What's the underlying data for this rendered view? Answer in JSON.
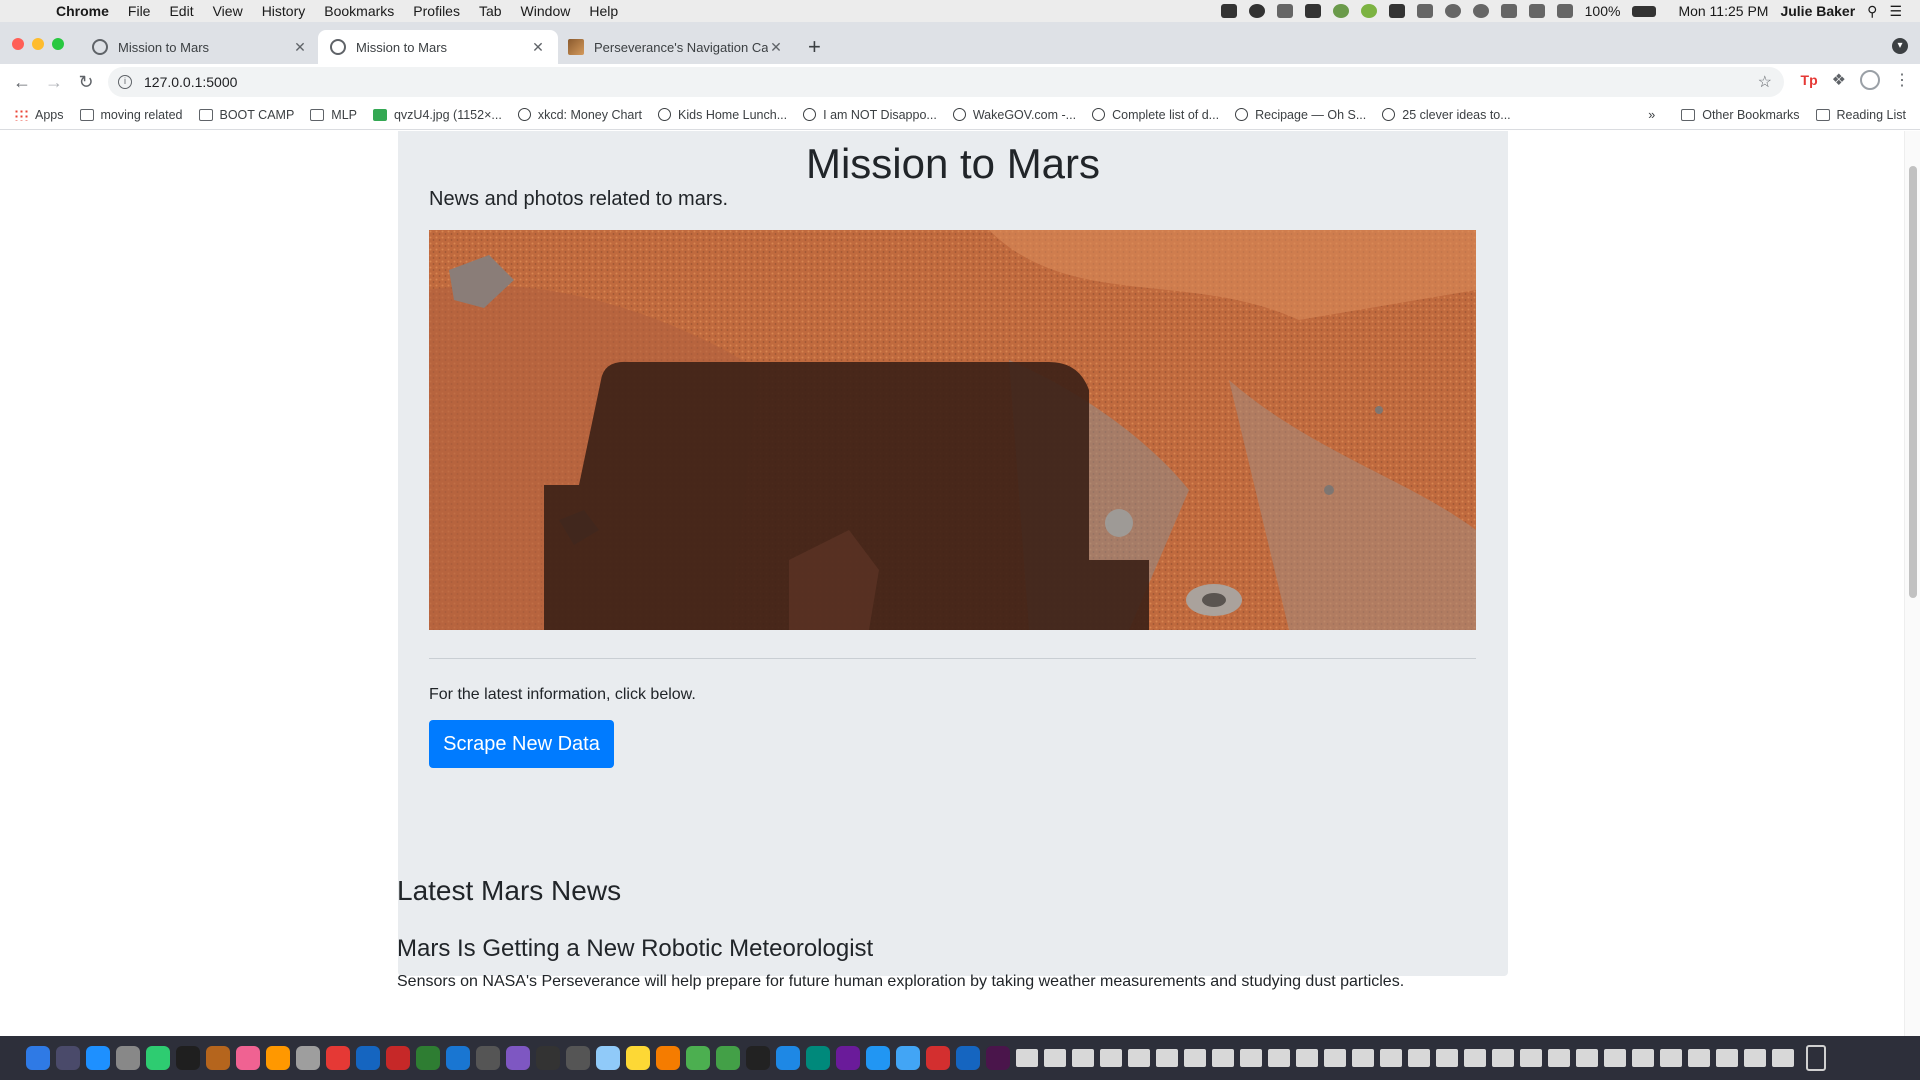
{
  "menubar": {
    "apple_glyph": "",
    "app_name": "Chrome",
    "items": [
      "File",
      "Edit",
      "View",
      "History",
      "Bookmarks",
      "Profiles",
      "Tab",
      "Window",
      "Help"
    ],
    "battery": "100%",
    "clock": "Mon 11:25 PM",
    "user": "Julie Baker"
  },
  "tabs": [
    {
      "title": "Mission to Mars",
      "active": false
    },
    {
      "title": "Mission to Mars",
      "active": true
    },
    {
      "title": "Perseverance's Navigation Cam",
      "active": false
    }
  ],
  "toolbar": {
    "url": "127.0.0.1:5000",
    "extension_label": "Tp"
  },
  "bookmarks": {
    "items": [
      {
        "label": "Apps",
        "icon": "apps-grid-icon"
      },
      {
        "label": "moving related",
        "icon": "folder-icon"
      },
      {
        "label": "BOOT CAMP",
        "icon": "folder-icon"
      },
      {
        "label": "MLP",
        "icon": "folder-icon"
      },
      {
        "label": "qvzU4.jpg (1152×...",
        "icon": "image-icon"
      },
      {
        "label": "xkcd: Money Chart",
        "icon": "globe-icon"
      },
      {
        "label": "Kids Home Lunch...",
        "icon": "globe-icon"
      },
      {
        "label": "I am NOT Disappo...",
        "icon": "globe-icon"
      },
      {
        "label": "WakeGOV.com -...",
        "icon": "globe-icon"
      },
      {
        "label": "Complete list of d...",
        "icon": "globe-icon"
      },
      {
        "label": "Recipage — Oh S...",
        "icon": "globe-icon"
      },
      {
        "label": "25 clever ideas to...",
        "icon": "globe-icon"
      }
    ],
    "overflow": "»",
    "other": "Other Bookmarks",
    "reading_list": "Reading List"
  },
  "page": {
    "title": "Mission to Mars",
    "lead": "News and photos related to mars.",
    "cta_text": "For the latest information, click below.",
    "scrape_button": "Scrape New Data",
    "news_heading": "Latest Mars News",
    "news_title": "Mars Is Getting a New Robotic Meteorologist",
    "news_teaser": "Sensors on NASA's Perseverance will help prepare for future human exploration by taking weather measurements and studying dust particles."
  },
  "colors": {
    "primary": "#007bff",
    "jumbotron": "#e9ecef",
    "mars_soil": "#c46a3c"
  }
}
